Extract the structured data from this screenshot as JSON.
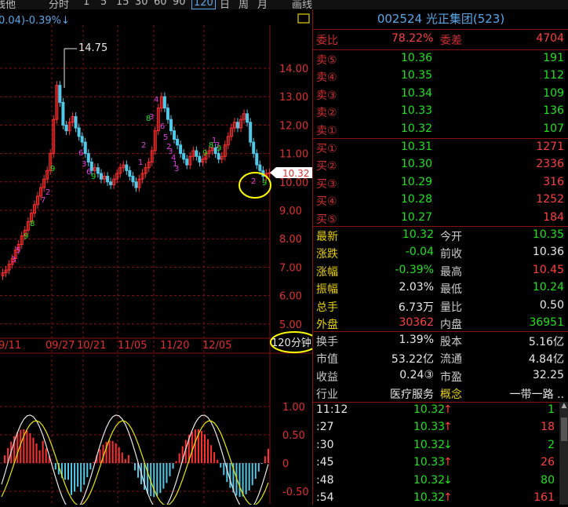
{
  "topbar": {
    "items": [
      "线他",
      "分时",
      "1",
      "5",
      "15",
      "30",
      "60",
      "90",
      "120",
      "日",
      "周",
      "月",
      "画线"
    ],
    "active": "120"
  },
  "chart": {
    "change_text": "0.04)-0.39%↓",
    "high_label": "14.75",
    "price_ticks": [
      "14.00",
      "13.00",
      "12.00",
      "11.00",
      "10.00",
      "9.00",
      "8.00",
      "7.00",
      "6.00",
      "5.00"
    ],
    "current_price_tag": "10.32",
    "dates": [
      "9/11",
      "09/27",
      "10/21",
      "11/05",
      "11/20",
      "12/05"
    ],
    "period_label": "120分钟",
    "macd_ticks": [
      "1.00",
      "0.50",
      "0",
      "-0.50"
    ],
    "colors": {
      "up": "#ff3030",
      "down": "#50c8e8",
      "grid": "#8a1010",
      "annot": "#e040e0",
      "green": "#20e020",
      "yellow": "#ffff00"
    },
    "annot_nums": [
      "3",
      "5",
      "9",
      "8",
      "7",
      "2",
      "9",
      "6",
      "3",
      "6",
      "9",
      "1",
      "2",
      "8",
      "3",
      "4",
      "6",
      "5",
      "2",
      "3",
      "4",
      "1",
      "3",
      "9",
      "8",
      "1",
      "3",
      "9",
      "2",
      "9"
    ]
  },
  "panel": {
    "title": "002524 光正集团(523)",
    "weibi": {
      "label": "委比",
      "value": "78.22%",
      "label2": "委差",
      "value2": "4704"
    },
    "asks": [
      {
        "label": "卖⑤",
        "price": "10.36",
        "vol": "191"
      },
      {
        "label": "卖④",
        "price": "10.35",
        "vol": "112"
      },
      {
        "label": "卖③",
        "price": "10.34",
        "vol": "109"
      },
      {
        "label": "卖②",
        "price": "10.33",
        "vol": "136"
      },
      {
        "label": "卖①",
        "price": "10.32",
        "vol": "107"
      }
    ],
    "bids": [
      {
        "label": "买①",
        "price": "10.31",
        "vol": "1271"
      },
      {
        "label": "买②",
        "price": "10.30",
        "vol": "2336"
      },
      {
        "label": "买③",
        "price": "10.29",
        "vol": "316"
      },
      {
        "label": "买④",
        "price": "10.28",
        "vol": "1252"
      },
      {
        "label": "买⑤",
        "price": "10.27",
        "vol": "184"
      }
    ],
    "stats": [
      {
        "l1": "最新",
        "v1": "10.32",
        "c1": "grn",
        "l2": "今开",
        "v2": "10.35",
        "c2": "grn"
      },
      {
        "l1": "涨跌",
        "v1": "-0.04",
        "c1": "grn",
        "l2": "前收",
        "v2": "10.36",
        "c2": "wht"
      },
      {
        "l1": "涨幅",
        "v1": "-0.39%",
        "c1": "grn",
        "l2": "最高",
        "v2": "10.45",
        "c2": "red"
      },
      {
        "l1": "振幅",
        "v1": "2.03%",
        "c1": "wht",
        "l2": "最低",
        "v2": "10.24",
        "c2": "grn"
      },
      {
        "l1": "总手",
        "v1": "6.73万",
        "c1": "wht",
        "l2": "量比",
        "v2": "0.50",
        "c2": "wht"
      },
      {
        "l1": "外盘",
        "v1": "30362",
        "c1": "red",
        "l2": "内盘",
        "v2": "36951",
        "c2": "grn"
      }
    ],
    "fin": [
      {
        "l1": "换手",
        "v1": "1.39%",
        "l2": "股本",
        "v2": "5.16亿"
      },
      {
        "l1": "市值",
        "v1": "53.22亿",
        "l2": "流通",
        "v2": "4.84亿"
      },
      {
        "l1": "收益",
        "v1": "0.24③",
        "l2": "市盈",
        "v2": "32.25"
      },
      {
        "l1": "行业",
        "v1": "医疗服务",
        "l2": "概念",
        "v2": "一带一路 .."
      }
    ],
    "ticks": [
      {
        "time": "11:12",
        "price": "10.32",
        "dir": "↑",
        "vol": "1",
        "c": "grn",
        "vc": "grn"
      },
      {
        "time": ":27",
        "price": "10.33",
        "dir": "↑",
        "vol": "18",
        "c": "grn",
        "vc": "red"
      },
      {
        "time": ":30",
        "price": "10.32",
        "dir": "↓",
        "vol": "2",
        "c": "grn",
        "vc": "grn"
      },
      {
        "time": ":45",
        "price": "10.33",
        "dir": "↑",
        "vol": "26",
        "c": "grn",
        "vc": "red"
      },
      {
        "time": ":48",
        "price": "10.32",
        "dir": "↓",
        "vol": "80",
        "c": "grn",
        "vc": "grn"
      },
      {
        "time": ":54",
        "price": "10.32",
        "dir": "↑",
        "vol": "161",
        "c": "grn",
        "vc": "red"
      }
    ]
  }
}
